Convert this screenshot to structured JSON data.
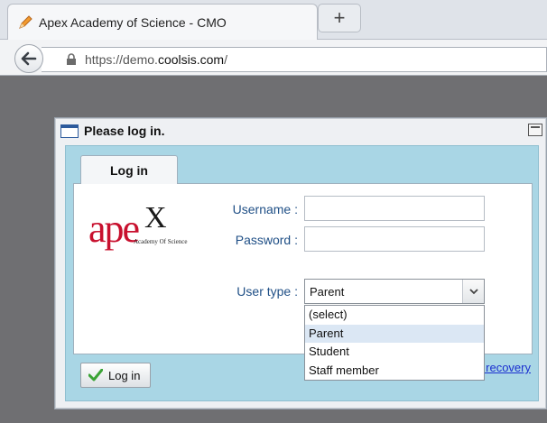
{
  "browser": {
    "tab_title": "Apex Academy of Science - CMO",
    "new_tab_label": "+",
    "url_prefix": "https://demo.",
    "url_host": "coolsis.com",
    "url_suffix": "/"
  },
  "dialog": {
    "title": "Please log in.",
    "tab_label": "Log in",
    "logo": {
      "text": "ape",
      "x_letter": "X",
      "subtitle": "Academy Of Science"
    },
    "username_label": "Username :",
    "username_value": "",
    "password_label": "Password :",
    "password_value": "",
    "usertype_label": "User type :",
    "usertype_selected": "Parent",
    "usertype_options": [
      "(select)",
      "Parent",
      "Student",
      "Staff member"
    ],
    "login_button": "Log in",
    "recovery_link": "Password recovery"
  },
  "colors": {
    "panel_background": "#a9d6e5",
    "label_text": "#1f4f86",
    "logo_red": "#c8102e",
    "link": "#1a2fd0"
  }
}
